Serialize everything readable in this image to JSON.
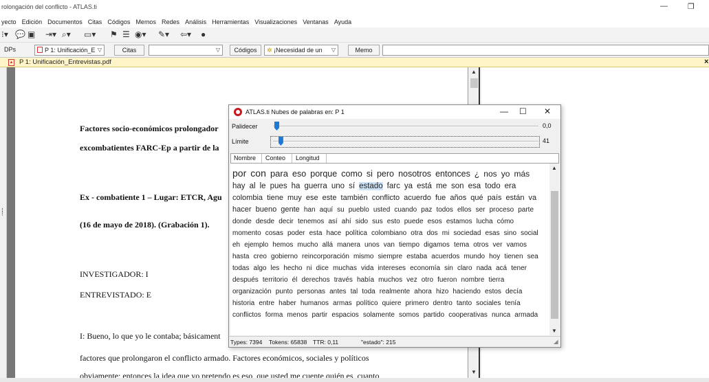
{
  "window": {
    "title": "rolongación del conflicto - ATLAS.ti",
    "minimize_glyph": "—",
    "restore_glyph": "❐"
  },
  "menu": [
    "yecto",
    "Edición",
    "Documentos",
    "Citas",
    "Códigos",
    "Memos",
    "Redes",
    "Análisis",
    "Herramientas",
    "Visualizaciones",
    "Ventanas",
    "Ayuda"
  ],
  "toolbar": {
    "icons": [
      "dropdown-chevron-icon",
      "comment-icon",
      "save-icon",
      "insert-icon",
      "binoculars-icon",
      "folder-icon",
      "code-icon",
      "list-icon",
      "xml-icon",
      "tools-icon",
      "back-icon",
      "bomb-icon"
    ]
  },
  "combobar": {
    "docs_label": "DPs",
    "doc_combo": "P 1: Unificación_E",
    "quotes_button": "Citas",
    "quotes_combo": "",
    "codes_button": "Códigos",
    "code_combo": "¡Necesidad de un",
    "memo_button": "Memo",
    "memo_combo": ""
  },
  "doc_tab": {
    "title": "P 1: Unificación_Entrevistas.pdf",
    "close_glyph": "×"
  },
  "document": {
    "lines": [
      "Factores socio-económicos prolongador",
      "excombatientes FARC-Ep a partir de la",
      "Ex - combatiente 1 – Lugar: ETCR, Agu",
      "(16 de mayo de 2018). (Grabación 1).",
      "INVESTIGADOR: I",
      "ENTREVISTADO:  E",
      "I: Bueno, lo que yo le contaba; básicament",
      "factores que prolongaron el conflicto armado.  Factores económicos, sociales y políticos",
      "obviamente; entonces la idea que yo pretendo es eso, que usted me cuente quién es, cuanto"
    ]
  },
  "dialog": {
    "title": "ATLAS.ti Nubes de palabras en: P 1",
    "palidecer_label": "Palidecer",
    "palidecer_value": "0,0",
    "palidecer_level": 0,
    "limite_label": "Límite",
    "limite_value": "41",
    "limite_level": 0.01,
    "tabs": [
      "Nombre",
      "Conteo",
      "Longitud"
    ],
    "cloud": [
      {
        "w": "por",
        "s": 14
      },
      {
        "w": "con",
        "s": 14
      },
      {
        "w": "para",
        "s": 13
      },
      {
        "w": "eso",
        "s": 12.5
      },
      {
        "w": "porque",
        "s": 12.5
      },
      {
        "w": "como",
        "s": 12.5
      },
      {
        "w": "si",
        "s": 12.5
      },
      {
        "w": "pero",
        "s": 12.5
      },
      {
        "w": "nosotros",
        "s": 12.5
      },
      {
        "w": "entonces",
        "s": 12.5
      },
      {
        "w": "¿",
        "s": 12
      },
      {
        "w": "nos",
        "s": 12
      },
      {
        "w": "yo",
        "s": 12
      },
      {
        "w": "más",
        "s": 12
      },
      {
        "w": "hay",
        "s": 11.5
      },
      {
        "w": "al",
        "s": 11.5
      },
      {
        "w": "le",
        "s": 11.5
      },
      {
        "w": "pues",
        "s": 11.5
      },
      {
        "w": "ha",
        "s": 11.5
      },
      {
        "w": "guerra",
        "s": 11.5
      },
      {
        "w": "uno",
        "s": 11.5
      },
      {
        "w": "sí",
        "s": 11.5
      },
      {
        "w": "estado",
        "s": 11.5,
        "hl": true
      },
      {
        "w": "farc",
        "s": 11.5
      },
      {
        "w": "ya",
        "s": 11.5
      },
      {
        "w": "está",
        "s": 11.5
      },
      {
        "w": "me",
        "s": 11.5
      },
      {
        "w": "son",
        "s": 11.5
      },
      {
        "w": "esa",
        "s": 11.5
      },
      {
        "w": "todo",
        "s": 11.5
      },
      {
        "w": "era",
        "s": 11.5
      },
      {
        "w": "colombia",
        "s": 11
      },
      {
        "w": "tiene",
        "s": 11
      },
      {
        "w": "muy",
        "s": 11
      },
      {
        "w": "ese",
        "s": 11
      },
      {
        "w": "este",
        "s": 11
      },
      {
        "w": "también",
        "s": 11
      },
      {
        "w": "conflicto",
        "s": 11
      },
      {
        "w": "acuerdo",
        "s": 11
      },
      {
        "w": "fue",
        "s": 11
      },
      {
        "w": "años",
        "s": 11
      },
      {
        "w": "qué",
        "s": 11
      },
      {
        "w": "país",
        "s": 11
      },
      {
        "w": "están",
        "s": 11
      },
      {
        "w": "va",
        "s": 11
      },
      {
        "w": "hacer",
        "s": 11
      },
      {
        "w": "bueno",
        "s": 11
      },
      {
        "w": "gente",
        "s": 11
      },
      {
        "w": "han",
        "s": 10
      },
      {
        "w": "aquí",
        "s": 10
      },
      {
        "w": "su",
        "s": 10
      },
      {
        "w": "pueblo",
        "s": 10
      },
      {
        "w": "usted",
        "s": 10
      },
      {
        "w": "cuando",
        "s": 10
      },
      {
        "w": "paz",
        "s": 10
      },
      {
        "w": "todos",
        "s": 10
      },
      {
        "w": "ellos",
        "s": 10
      },
      {
        "w": "ser",
        "s": 10
      },
      {
        "w": "proceso",
        "s": 10
      },
      {
        "w": "parte",
        "s": 10
      },
      {
        "w": "donde",
        "s": 10
      },
      {
        "w": "desde",
        "s": 10
      },
      {
        "w": "decir",
        "s": 10
      },
      {
        "w": "tenemos",
        "s": 10
      },
      {
        "w": "así",
        "s": 10
      },
      {
        "w": "ahí",
        "s": 10
      },
      {
        "w": "sido",
        "s": 10
      },
      {
        "w": "sus",
        "s": 10
      },
      {
        "w": "esto",
        "s": 10
      },
      {
        "w": "puede",
        "s": 10
      },
      {
        "w": "esos",
        "s": 10
      },
      {
        "w": "estamos",
        "s": 10
      },
      {
        "w": "lucha",
        "s": 10
      },
      {
        "w": "cómo",
        "s": 10
      },
      {
        "w": "momento",
        "s": 10
      },
      {
        "w": "cosas",
        "s": 10
      },
      {
        "w": "poder",
        "s": 10
      },
      {
        "w": "esta",
        "s": 10
      },
      {
        "w": "hace",
        "s": 10
      },
      {
        "w": "política",
        "s": 10
      },
      {
        "w": "colombiano",
        "s": 10
      },
      {
        "w": "otra",
        "s": 10
      },
      {
        "w": "dos",
        "s": 10
      },
      {
        "w": "mi",
        "s": 10
      },
      {
        "w": "sociedad",
        "s": 10
      },
      {
        "w": "esas",
        "s": 10
      },
      {
        "w": "sino",
        "s": 10
      },
      {
        "w": "social",
        "s": 10
      },
      {
        "w": "eh",
        "s": 10
      },
      {
        "w": "ejemplo",
        "s": 10
      },
      {
        "w": "hemos",
        "s": 10
      },
      {
        "w": "mucho",
        "s": 10
      },
      {
        "w": "allá",
        "s": 10
      },
      {
        "w": "manera",
        "s": 10
      },
      {
        "w": "unos",
        "s": 10
      },
      {
        "w": "van",
        "s": 10
      },
      {
        "w": "tiempo",
        "s": 10
      },
      {
        "w": "digamos",
        "s": 10
      },
      {
        "w": "tema",
        "s": 10
      },
      {
        "w": "otros",
        "s": 10
      },
      {
        "w": "ver",
        "s": 10
      },
      {
        "w": "vamos",
        "s": 10
      },
      {
        "w": "hasta",
        "s": 10
      },
      {
        "w": "creo",
        "s": 10
      },
      {
        "w": "gobierno",
        "s": 10
      },
      {
        "w": "reincorporación",
        "s": 10
      },
      {
        "w": "mismo",
        "s": 10
      },
      {
        "w": "siempre",
        "s": 10
      },
      {
        "w": "estaba",
        "s": 10
      },
      {
        "w": "acuerdos",
        "s": 10
      },
      {
        "w": "mundo",
        "s": 10
      },
      {
        "w": "hoy",
        "s": 10
      },
      {
        "w": "tienen",
        "s": 10
      },
      {
        "w": "sea",
        "s": 10
      },
      {
        "w": "todas",
        "s": 10
      },
      {
        "w": "algo",
        "s": 10
      },
      {
        "w": "les",
        "s": 10
      },
      {
        "w": "hecho",
        "s": 10
      },
      {
        "w": "ni",
        "s": 10
      },
      {
        "w": "dice",
        "s": 10
      },
      {
        "w": "muchas",
        "s": 10
      },
      {
        "w": "vida",
        "s": 10
      },
      {
        "w": "intereses",
        "s": 10
      },
      {
        "w": "economía",
        "s": 10
      },
      {
        "w": "sin",
        "s": 10
      },
      {
        "w": "claro",
        "s": 10
      },
      {
        "w": "nada",
        "s": 10
      },
      {
        "w": "acá",
        "s": 10
      },
      {
        "w": "tener",
        "s": 10
      },
      {
        "w": "después",
        "s": 10
      },
      {
        "w": "territorio",
        "s": 10
      },
      {
        "w": "él",
        "s": 10
      },
      {
        "w": "derechos",
        "s": 10
      },
      {
        "w": "través",
        "s": 10
      },
      {
        "w": "había",
        "s": 10
      },
      {
        "w": "muchos",
        "s": 10
      },
      {
        "w": "vez",
        "s": 10
      },
      {
        "w": "otro",
        "s": 10
      },
      {
        "w": "fueron",
        "s": 10
      },
      {
        "w": "nombre",
        "s": 10
      },
      {
        "w": "tierra",
        "s": 10
      },
      {
        "w": "organización",
        "s": 10
      },
      {
        "w": "punto",
        "s": 10
      },
      {
        "w": "personas",
        "s": 10
      },
      {
        "w": "antes",
        "s": 10
      },
      {
        "w": "tal",
        "s": 10
      },
      {
        "w": "toda",
        "s": 10
      },
      {
        "w": "realmente",
        "s": 10
      },
      {
        "w": "ahora",
        "s": 10
      },
      {
        "w": "hizo",
        "s": 10
      },
      {
        "w": "haciendo",
        "s": 10
      },
      {
        "w": "estos",
        "s": 10
      },
      {
        "w": "decía",
        "s": 10
      },
      {
        "w": "historia",
        "s": 10
      },
      {
        "w": "entre",
        "s": 10
      },
      {
        "w": "haber",
        "s": 10
      },
      {
        "w": "humanos",
        "s": 10
      },
      {
        "w": "armas",
        "s": 10
      },
      {
        "w": "político",
        "s": 10
      },
      {
        "w": "quiere",
        "s": 10
      },
      {
        "w": "primero",
        "s": 10
      },
      {
        "w": "dentro",
        "s": 10
      },
      {
        "w": "tanto",
        "s": 10
      },
      {
        "w": "sociales",
        "s": 10
      },
      {
        "w": "tenía",
        "s": 10
      },
      {
        "w": "conflictos",
        "s": 10
      },
      {
        "w": "forma",
        "s": 10
      },
      {
        "w": "menos",
        "s": 10
      },
      {
        "w": "partir",
        "s": 10
      },
      {
        "w": "espacios",
        "s": 10
      },
      {
        "w": "solamente",
        "s": 10
      },
      {
        "w": "somos",
        "s": 10
      },
      {
        "w": "partido",
        "s": 10
      },
      {
        "w": "cooperativas",
        "s": 10
      },
      {
        "w": "nunca",
        "s": 10
      },
      {
        "w": "armada",
        "s": 10
      }
    ],
    "status": {
      "types": "Types: 7394",
      "tokens": "Tokens: 65838",
      "ttr": "TTR: 0,11",
      "selected": "\"estado\": 215"
    }
  },
  "colors": {
    "accent": "#1e78d6",
    "doc_tab_bg": "#fff5c8",
    "logo_red": "#c8171e",
    "highlight": "#cfe3f5"
  }
}
